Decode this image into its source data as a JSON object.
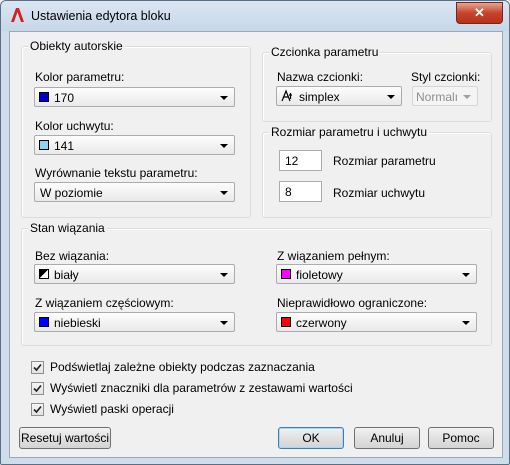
{
  "window": {
    "title": "Ustawienia edytora bloku",
    "close_glyph": "✕"
  },
  "authoring": {
    "group_label": "Obiekty autorskie",
    "param_color_label": "Kolor parametru:",
    "param_color_value": "170",
    "param_color_swatch": "#0000c8",
    "grip_color_label": "Kolor uchwytu:",
    "grip_color_value": "141",
    "grip_color_swatch": "#8fd3f0",
    "text_align_label": "Wyrównanie tekstu parametru:",
    "text_align_value": "W poziomie"
  },
  "font": {
    "group_label": "Czcionka parametru",
    "name_label": "Nazwa czcionki:",
    "name_value": "simplex",
    "style_label": "Styl czcionki:",
    "style_value": "Normalı"
  },
  "size": {
    "group_label": "Rozmiar parametru i uchwytu",
    "param_size_value": "12",
    "param_size_label": "Rozmiar parametru",
    "grip_size_value": "8",
    "grip_size_label": "Rozmiar uchwytu"
  },
  "constraint": {
    "group_label": "Stan wiązania",
    "unconstrained_label": "Bez wiązania:",
    "unconstrained_value": "biały",
    "unconstrained_swatch": "halftone",
    "full_label": "Z wiązaniem pełnym:",
    "full_value": "fioletowy",
    "full_swatch": "#ff00ff",
    "partial_label": "Z wiązaniem częściowym:",
    "partial_value": "niebieski",
    "partial_swatch": "#0000ff",
    "over_label": "Nieprawidłowo ograniczone:",
    "over_value": "czerwony",
    "over_swatch": "#ff0000"
  },
  "options": [
    {
      "label": "Podświetlaj zależne obiekty podczas zaznaczania",
      "checked": true
    },
    {
      "label": "Wyświetl znaczniki dla parametrów z zestawami wartości",
      "checked": true
    },
    {
      "label": "Wyświetl paski operacji",
      "checked": true
    }
  ],
  "buttons": {
    "reset": "Resetuj wartości",
    "ok": "OK",
    "cancel": "Anuluj",
    "help": "Pomoc"
  },
  "icons": {
    "app": "autocad-a-icon",
    "font": "font-glyph-icon",
    "check": "checkmark-icon"
  }
}
